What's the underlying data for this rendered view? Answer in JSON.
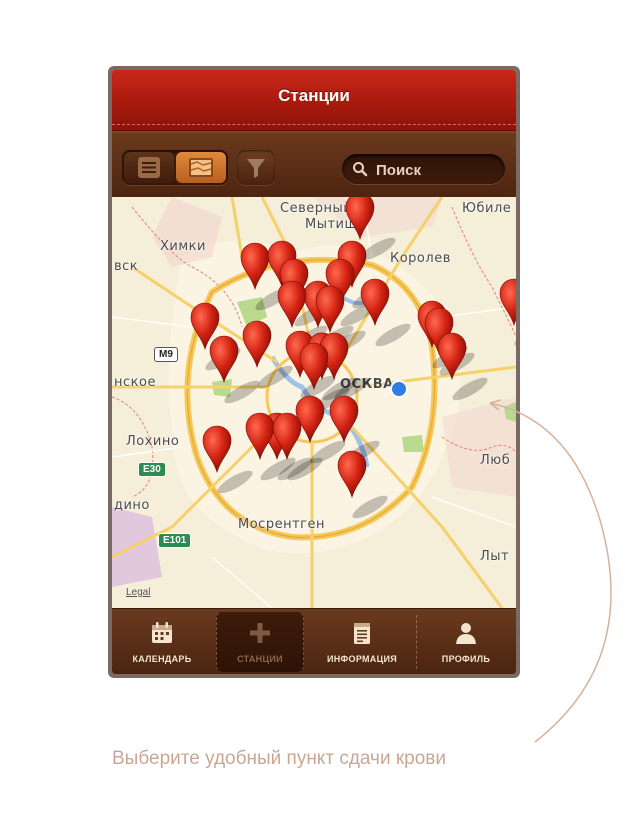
{
  "header": {
    "title": "Станции"
  },
  "toolbar": {
    "view_mode_selected": "map",
    "search": {
      "placeholder": "Поиск",
      "value": ""
    }
  },
  "map": {
    "labels": [
      {
        "id": "severny",
        "text": "Северный"
      },
      {
        "id": "mytishchi",
        "text": "Мытищи"
      },
      {
        "id": "yubileyny",
        "text": "Юбиле"
      },
      {
        "id": "khimki",
        "text": "Химки"
      },
      {
        "id": "vsk",
        "text": "вск"
      },
      {
        "id": "korolev",
        "text": "Королев"
      },
      {
        "id": "nskoe",
        "text": "нское"
      },
      {
        "id": "moskva",
        "text": "ОСКВА"
      },
      {
        "id": "lokhino",
        "text": "Лохино"
      },
      {
        "id": "lyub",
        "text": "Люб"
      },
      {
        "id": "dino",
        "text": "дино"
      },
      {
        "id": "mosrentgen",
        "text": "Мосрентген"
      },
      {
        "id": "lyt",
        "text": "Лыт"
      }
    ],
    "road_shields": [
      {
        "id": "m9",
        "text": "M9"
      },
      {
        "id": "e30",
        "text": "E30"
      },
      {
        "id": "e101",
        "text": "E101"
      }
    ],
    "legal": "Legal",
    "station_pin_color": "#d42414",
    "user_location_color": "#2f7de1"
  },
  "tabbar": {
    "tabs": [
      {
        "id": "calendar",
        "label": "КАЛЕНДАРЬ",
        "icon": "calendar-icon",
        "active": false
      },
      {
        "id": "stations",
        "label": "СТАНЦИИ",
        "icon": "plus-icon",
        "active": true
      },
      {
        "id": "info",
        "label": "ИНФОРМАЦИЯ",
        "icon": "notepad-icon",
        "active": false
      },
      {
        "id": "profile",
        "label": "ПРОФИЛЬ",
        "icon": "person-icon",
        "active": false
      }
    ]
  },
  "caption": "Выберите удобный пункт сдачи крови",
  "colors": {
    "header_red": "#b01e10",
    "toolbar_brown": "#5a2d15",
    "accent_orange": "#d07a30",
    "caption": "#c9a794"
  }
}
